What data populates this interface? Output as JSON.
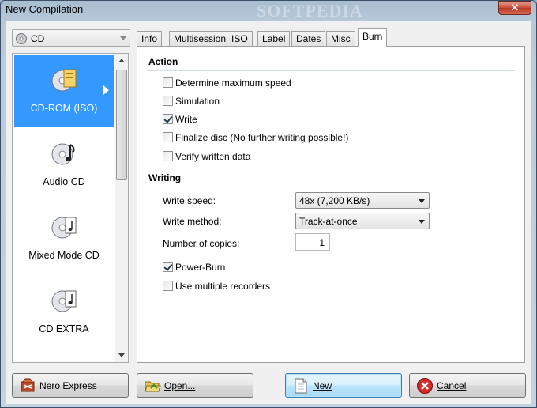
{
  "window": {
    "title": "New Compilation",
    "close_symbol": "✕"
  },
  "media_select": {
    "value": "CD"
  },
  "compilation_types": [
    {
      "label": "CD-ROM (ISO)",
      "selected": true
    },
    {
      "label": "Audio CD",
      "selected": false
    },
    {
      "label": "Mixed Mode CD",
      "selected": false
    },
    {
      "label": "CD EXTRA",
      "selected": false
    }
  ],
  "tabs": [
    "Info",
    "Multisession",
    "ISO",
    "Label",
    "Dates",
    "Misc",
    "Burn"
  ],
  "active_tab": "Burn",
  "burn": {
    "action_header": "Action",
    "action_options": [
      {
        "label": "Determine maximum speed",
        "checked": false
      },
      {
        "label": "Simulation",
        "checked": false
      },
      {
        "label": "Write",
        "checked": true
      },
      {
        "label": "Finalize disc (No further writing possible!)",
        "checked": false
      },
      {
        "label": "Verify written data",
        "checked": false
      }
    ],
    "writing_header": "Writing",
    "write_speed_label": "Write speed:",
    "write_speed_value": "48x (7,200 KB/s)",
    "write_method_label": "Write method:",
    "write_method_value": "Track-at-once",
    "copies_label": "Number of copies:",
    "copies_value": "1",
    "writing_options": [
      {
        "label": "Power-Burn",
        "checked": true
      },
      {
        "label": "Use multiple recorders",
        "checked": false
      }
    ]
  },
  "buttons": {
    "nero_express": "Nero Express",
    "open": "Open...",
    "new": "New",
    "cancel": "Cancel"
  },
  "watermark": "SOFTPEDIA",
  "colors": {
    "selection": "#3399ff",
    "cancel_icon": "#d42a2a"
  }
}
